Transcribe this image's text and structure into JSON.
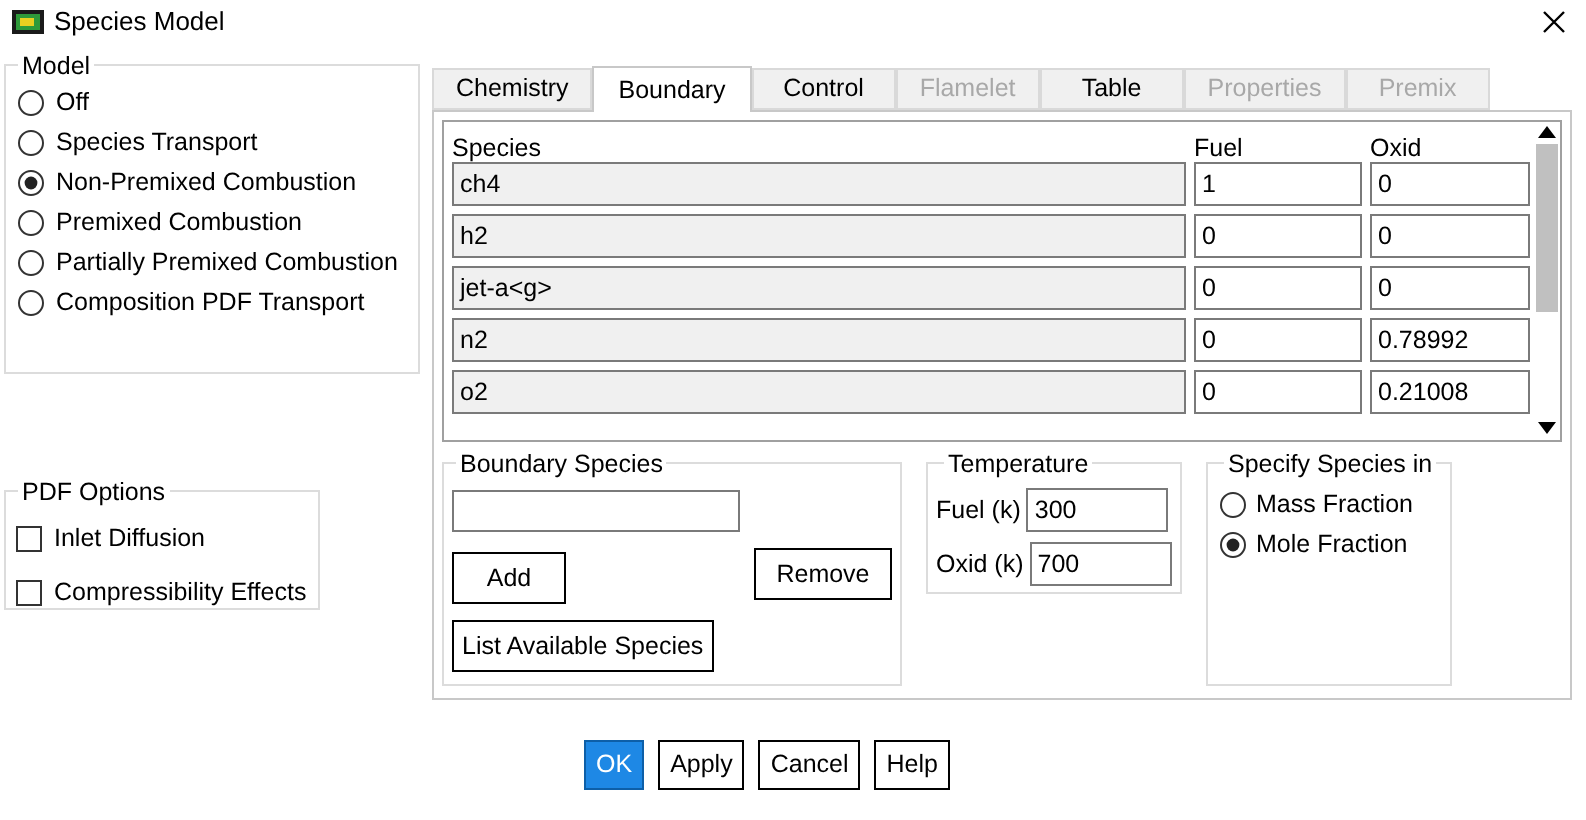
{
  "window": {
    "title": "Species Model"
  },
  "model": {
    "label": "Model",
    "options": [
      {
        "label": "Off",
        "selected": false
      },
      {
        "label": "Species Transport",
        "selected": false
      },
      {
        "label": "Non-Premixed Combustion",
        "selected": true
      },
      {
        "label": "Premixed Combustion",
        "selected": false
      },
      {
        "label": "Partially Premixed Combustion",
        "selected": false
      },
      {
        "label": "Composition PDF Transport",
        "selected": false
      }
    ]
  },
  "pdf_options": {
    "label": "PDF Options",
    "items": [
      {
        "label": "Inlet Diffusion",
        "checked": false
      },
      {
        "label": "Compressibility Effects",
        "checked": false
      }
    ]
  },
  "tabs": [
    {
      "label": "Chemistry",
      "selected": false,
      "disabled": false
    },
    {
      "label": "Boundary",
      "selected": true,
      "disabled": false
    },
    {
      "label": "Control",
      "selected": false,
      "disabled": false
    },
    {
      "label": "Flamelet",
      "selected": false,
      "disabled": true
    },
    {
      "label": "Table",
      "selected": false,
      "disabled": false
    },
    {
      "label": "Properties",
      "selected": false,
      "disabled": true
    },
    {
      "label": "Premix",
      "selected": false,
      "disabled": true
    }
  ],
  "species_table": {
    "columns": [
      "Species",
      "Fuel",
      "Oxid"
    ],
    "rows": [
      {
        "species": "ch4",
        "fuel": "1",
        "oxid": "0"
      },
      {
        "species": "h2",
        "fuel": "0",
        "oxid": "0"
      },
      {
        "species": "jet-a<g>",
        "fuel": "0",
        "oxid": "0"
      },
      {
        "species": "n2",
        "fuel": "0",
        "oxid": "0.78992"
      },
      {
        "species": "o2",
        "fuel": "0",
        "oxid": "0.21008"
      }
    ]
  },
  "boundary_species": {
    "label": "Boundary Species",
    "buttons": [
      "Add",
      "Remove",
      "List Available Species"
    ]
  },
  "temperature": {
    "label": "Temperature",
    "fields": [
      {
        "label": "Fuel (k)",
        "value": "300"
      },
      {
        "label": "Oxid (k)",
        "value": "700"
      }
    ]
  },
  "specify_species_in": {
    "label": "Specify Species in",
    "options": [
      {
        "label": "Mass Fraction",
        "selected": false
      },
      {
        "label": "Mole Fraction",
        "selected": true
      }
    ]
  },
  "buttons": [
    {
      "label": "OK",
      "default": true
    },
    {
      "label": "Apply",
      "default": false
    },
    {
      "label": "Cancel",
      "default": false
    },
    {
      "label": "Help",
      "default": false
    }
  ]
}
